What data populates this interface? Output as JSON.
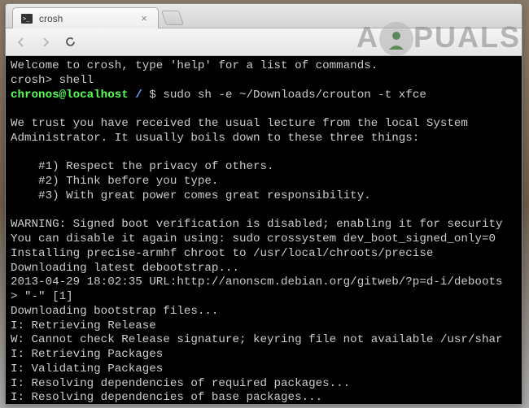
{
  "watermark": "A  PUALS",
  "browser": {
    "tab": {
      "title": "crosh"
    }
  },
  "terminal": {
    "welcome": "Welcome to crosh, type 'help' for a list of commands.",
    "prompt1_prefix": "crosh> ",
    "prompt1_cmd": "shell",
    "prompt2_userhost": "chronos@localhost",
    "prompt2_path": " / ",
    "prompt2_symbol": "$ ",
    "prompt2_cmd": "sudo sh -e ~/Downloads/crouton -t xfce",
    "lecture_l1": "We trust you have received the usual lecture from the local System",
    "lecture_l2": "Administrator. It usually boils down to these three things:",
    "rule1": "    #1) Respect the privacy of others.",
    "rule2": "    #2) Think before you type.",
    "rule3": "    #3) With great power comes great responsibility.",
    "warn1": "WARNING: Signed boot verification is disabled; enabling it for security",
    "warn2": "You can disable it again using: sudo crossystem dev_boot_signed_only=0",
    "install1": "Installing precise-armhf chroot to /usr/local/chroots/precise",
    "download1": "Downloading latest debootstrap...",
    "url_line": "2013-04-29 18:02:35 URL:http://anonscm.debian.org/gitweb/?p=d-i/deboots",
    "url_line2": "> \"-\" [1]",
    "download2": "Downloading bootstrap files...",
    "s1": "I: Retrieving Release",
    "s2": "W: Cannot check Release signature; keyring file not available /usr/shar",
    "s3": "I: Retrieving Packages",
    "s4": "I: Validating Packages",
    "s5": "I: Resolving dependencies of required packages...",
    "s6": "I: Resolving dependencies of base packages..."
  }
}
